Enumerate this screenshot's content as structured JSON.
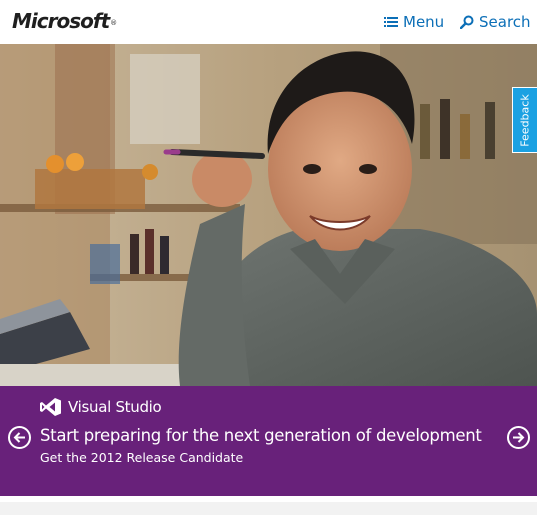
{
  "header": {
    "logo_text": "Microsoft",
    "trademark": "®",
    "menu_label": "Menu",
    "search_label": "Search",
    "menu_icon": "hamburger-icon",
    "search_icon": "magnifier-icon",
    "link_color": "#0c6fb7"
  },
  "feedback": {
    "label": "Feedback",
    "color": "#1ba1e2"
  },
  "promo": {
    "brand_name": "Visual Studio",
    "headline": "Start preparing for the next generation of development",
    "link": "Get the 2012 Release Candidate",
    "prev_icon": "arrow-left-circle-icon",
    "next_icon": "arrow-right-circle-icon",
    "background": "#68217a"
  },
  "hero": {
    "image": "man-with-pen-photo"
  }
}
